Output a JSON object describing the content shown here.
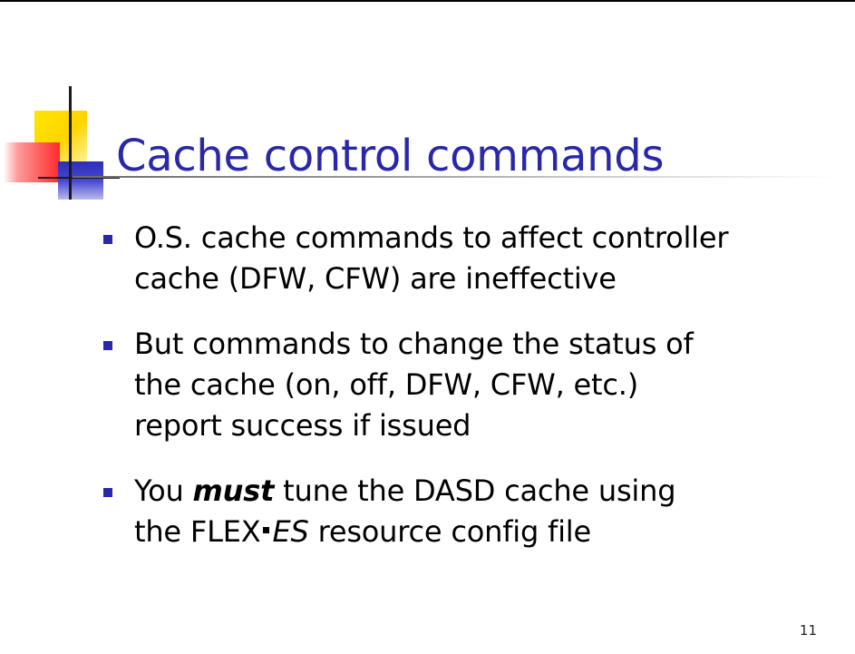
{
  "slide": {
    "title": "Cache control commands",
    "number": "11",
    "bullets": [
      {
        "lines": [
          "O.S. cache commands to affect controller",
          "cache (DFW, CFW) are ineffective"
        ]
      },
      {
        "lines": [
          "But commands to change the status of",
          "the cache (on, off, DFW, CFW, etc.)",
          "report success if issued"
        ]
      },
      {
        "b3_part1": "You ",
        "b3_emph": "must",
        "b3_part2": " tune the DASD cache using",
        "b3_line2_a": "the FLEX",
        "b3_line2_b": "ES",
        "b3_line2_c": " resource config file"
      }
    ]
  },
  "colors": {
    "title": "#2828a8",
    "bullet": "#2828a8",
    "logo_yellow": "#ffd400",
    "logo_red": "#ff2a2a",
    "logo_blue": "#3636c0"
  },
  "icons": {
    "logo": "decorative-squares-crosshair-logo",
    "bullet": "square-bullet"
  }
}
